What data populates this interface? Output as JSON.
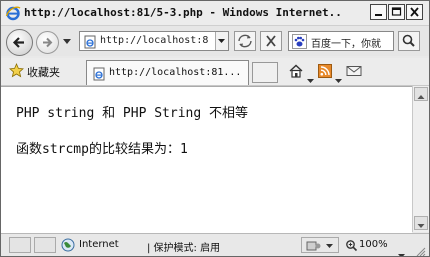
{
  "window": {
    "title": "http://localhost:81/5-3.php - Windows Internet..."
  },
  "address_bar": {
    "url": "http://localhost:8"
  },
  "search": {
    "text": "百度一下，你就"
  },
  "favorites": {
    "label": "收藏夹"
  },
  "tab": {
    "title": "http://localhost:81..."
  },
  "page": {
    "line1": "PHP string 和 PHP String 不相等",
    "line2": "函数strcmp的比较结果为：1"
  },
  "status_bar": {
    "zone": "Internet",
    "protected_mode": "| 保护模式: 启用",
    "zoom": "100%"
  },
  "colors": {
    "ie_blue": "#2a6fd6",
    "rss_orange": "#e8892a",
    "globe_green": "#3a8a3a"
  }
}
